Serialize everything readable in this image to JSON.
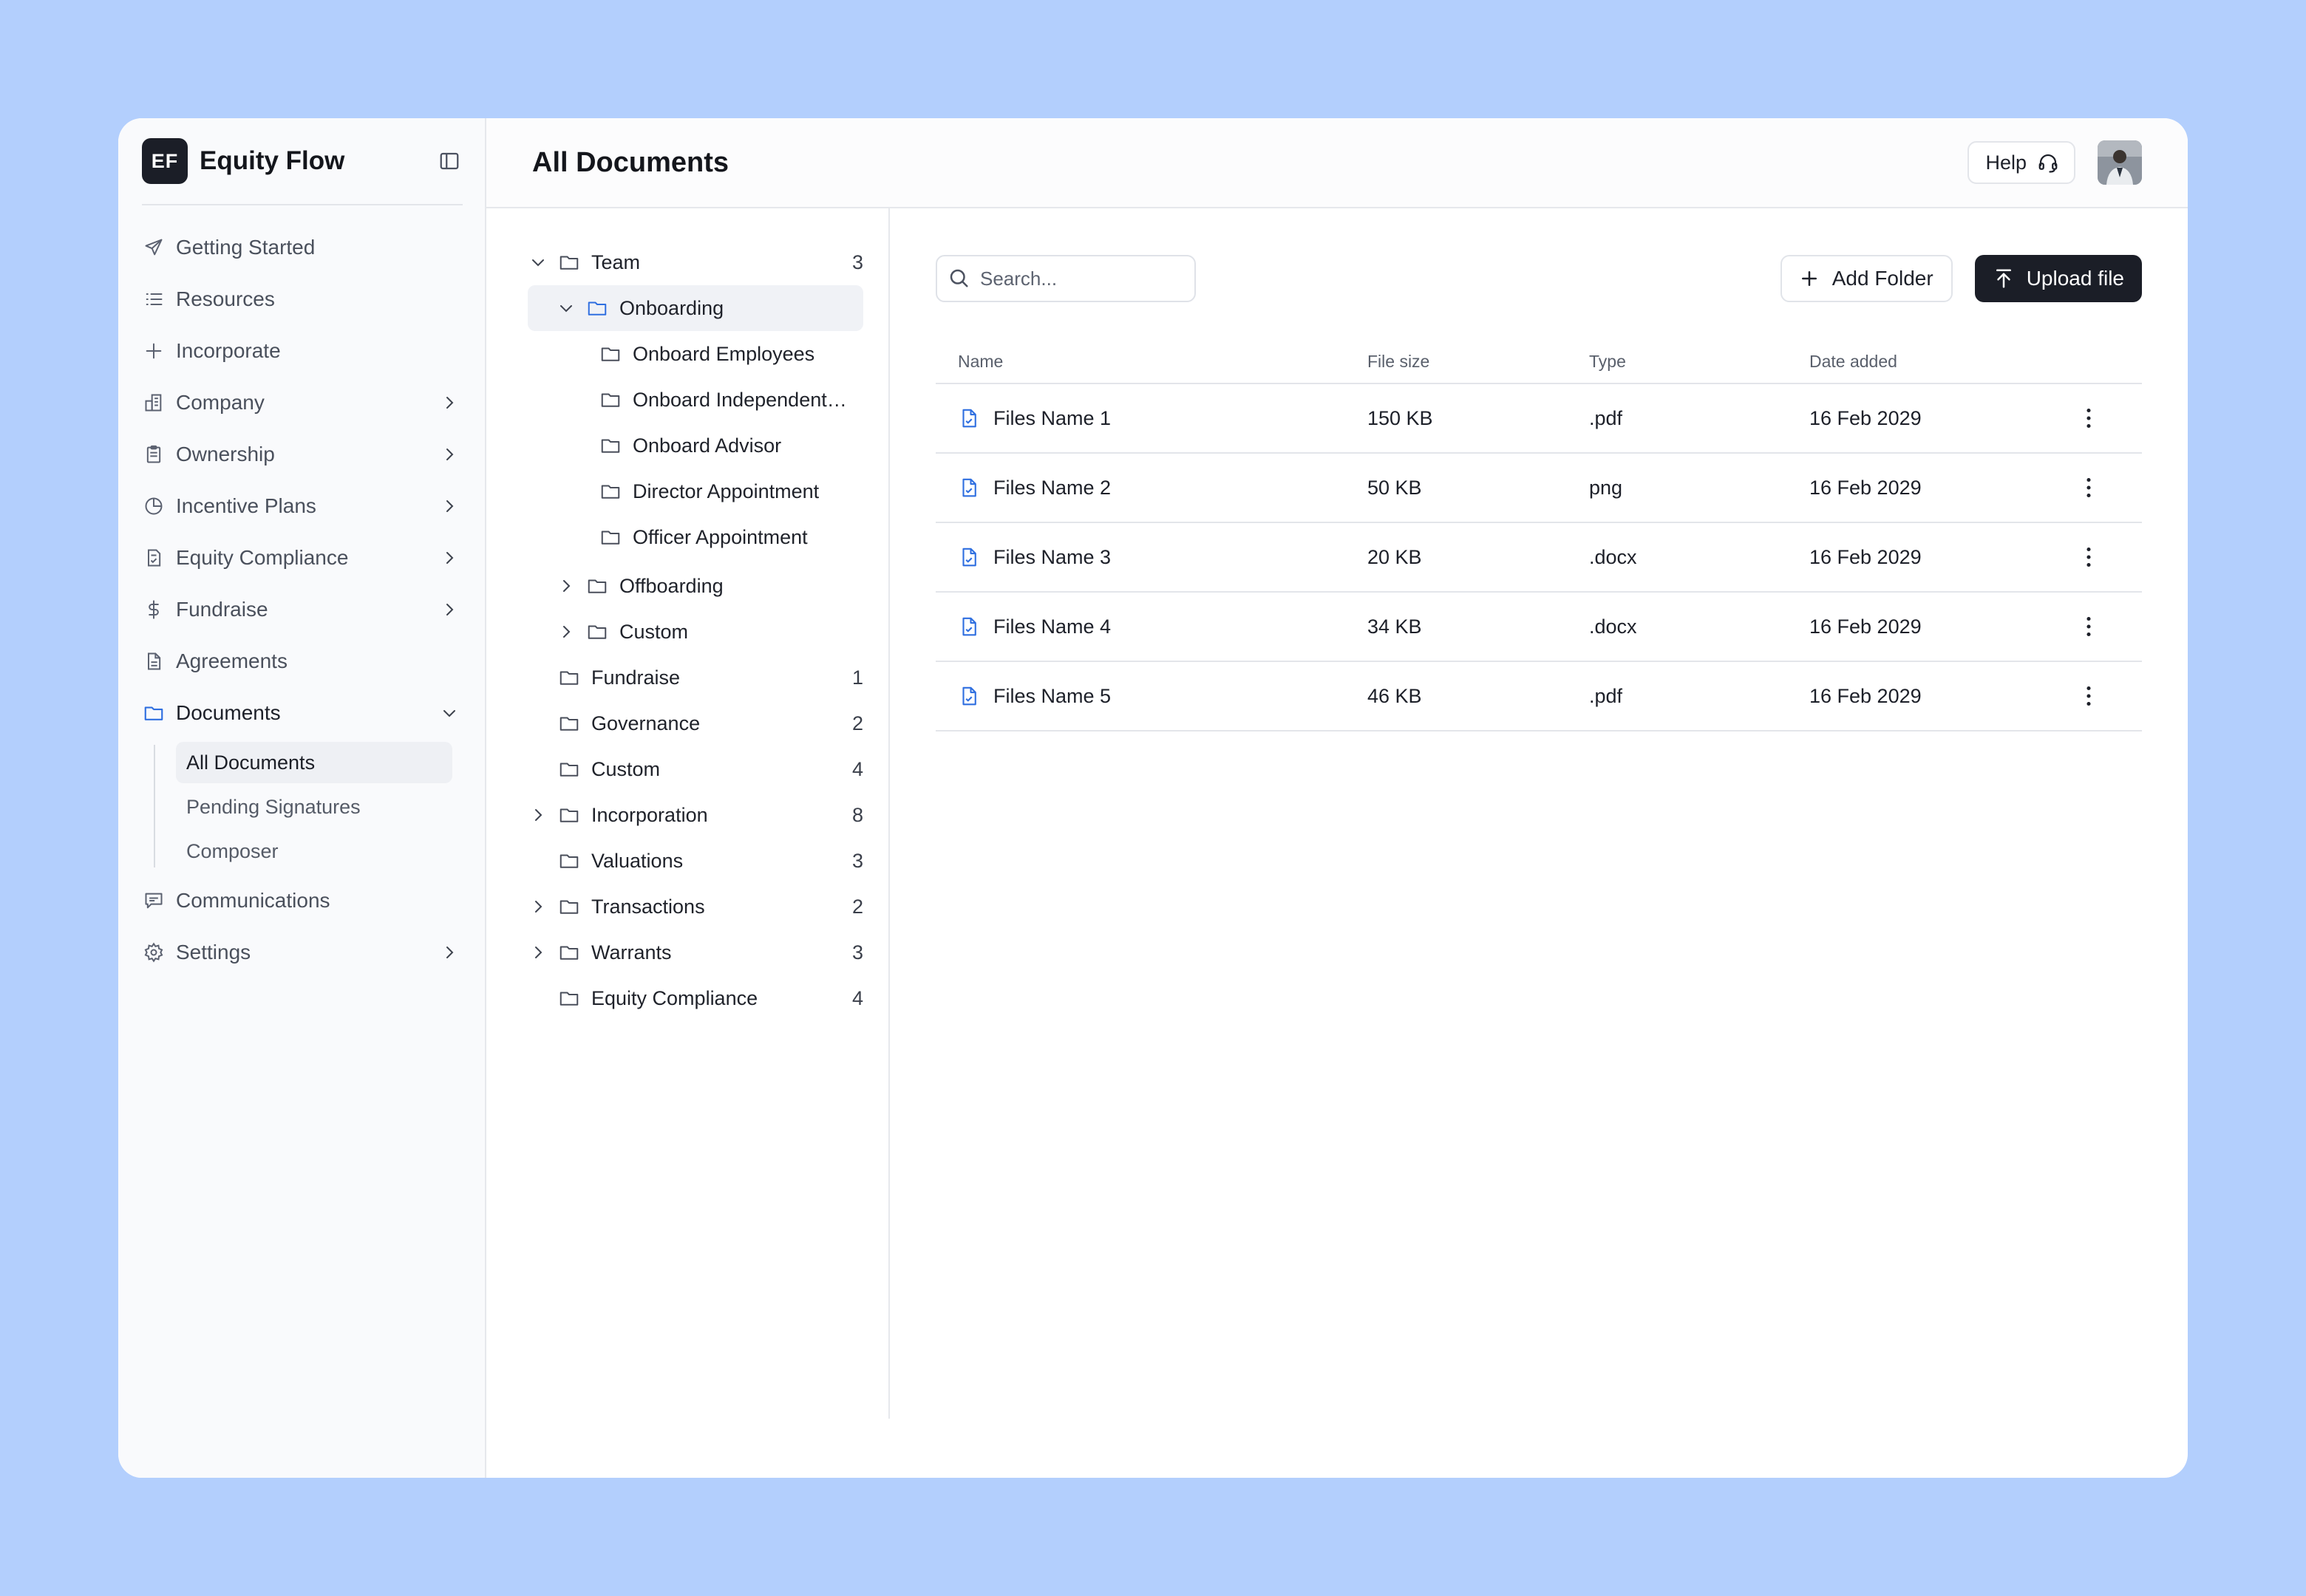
{
  "brand": {
    "logo_text": "EF",
    "name": "Equity Flow"
  },
  "sidebar": {
    "items": [
      {
        "label": "Getting Started",
        "icon": "rocket-icon",
        "has_chevron": false
      },
      {
        "label": "Resources",
        "icon": "list-icon",
        "has_chevron": false
      },
      {
        "label": "Incorporate",
        "icon": "plus-icon",
        "has_chevron": false
      },
      {
        "label": "Company",
        "icon": "building-icon",
        "has_chevron": true
      },
      {
        "label": "Ownership",
        "icon": "clipboard-icon",
        "has_chevron": true
      },
      {
        "label": "Incentive Plans",
        "icon": "pie-icon",
        "has_chevron": true
      },
      {
        "label": "Equity Compliance",
        "icon": "doc-check-icon",
        "has_chevron": true
      },
      {
        "label": "Fundraise",
        "icon": "dollar-icon",
        "has_chevron": true
      },
      {
        "label": "Agreements",
        "icon": "document-icon",
        "has_chevron": false
      },
      {
        "label": "Documents",
        "icon": "folder-icon",
        "has_chevron": true,
        "expanded": true
      }
    ],
    "documents_sub": [
      "All Documents",
      "Pending Signatures",
      "Composer"
    ],
    "bottom_items": [
      {
        "label": "Communications",
        "icon": "chat-icon",
        "has_chevron": false
      },
      {
        "label": "Settings",
        "icon": "gear-icon",
        "has_chevron": true
      }
    ]
  },
  "header": {
    "title": "All Documents",
    "help_label": "Help"
  },
  "tree": {
    "team": {
      "label": "Team",
      "count": "3"
    },
    "onboarding": {
      "label": "Onboarding"
    },
    "onboarding_children": [
      "Onboard Employees",
      "Onboard Independent…",
      "Onboard Advisor",
      "Director Appointment",
      "Officer Appointment"
    ],
    "offboarding": {
      "label": "Offboarding"
    },
    "custom_sub": {
      "label": "Custom"
    },
    "root_folders": [
      {
        "label": "Fundraise",
        "count": "1",
        "expandable": false
      },
      {
        "label": "Governance",
        "count": "2",
        "expandable": false
      },
      {
        "label": "Custom",
        "count": "4",
        "expandable": false
      },
      {
        "label": "Incorporation",
        "count": "8",
        "expandable": true
      },
      {
        "label": "Valuations",
        "count": "3",
        "expandable": false
      },
      {
        "label": "Transactions",
        "count": "2",
        "expandable": true
      },
      {
        "label": "Warrants",
        "count": "3",
        "expandable": true
      },
      {
        "label": "Equity Compliance",
        "count": "4",
        "expandable": false
      }
    ]
  },
  "files": {
    "search_placeholder": "Search...",
    "add_folder_label": "Add Folder",
    "upload_label": "Upload file",
    "columns": {
      "name": "Name",
      "size": "File size",
      "type": "Type",
      "date": "Date added"
    },
    "rows": [
      {
        "name": "Files Name 1",
        "size": "150 KB",
        "type": ".pdf",
        "date": "16 Feb 2029"
      },
      {
        "name": "Files Name 2",
        "size": "50 KB",
        "type": "png",
        "date": "16 Feb 2029"
      },
      {
        "name": "Files Name 3",
        "size": "20 KB",
        "type": ".docx",
        "date": "16 Feb 2029"
      },
      {
        "name": "Files Name 4",
        "size": "34 KB",
        "type": ".docx",
        "date": "16 Feb 2029"
      },
      {
        "name": "Files Name 5",
        "size": "46 KB",
        "type": ".pdf",
        "date": "16 Feb 2029"
      }
    ]
  },
  "colors": {
    "accent": "#2f6fe0",
    "dark": "#1b1e27",
    "background": "#b3cffd"
  }
}
